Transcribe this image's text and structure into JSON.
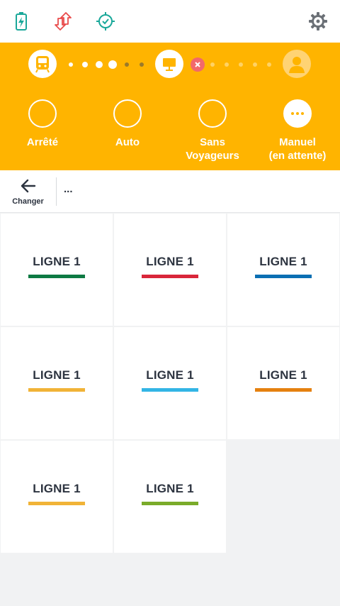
{
  "topbar": {
    "icons": [
      "battery-charging-icon",
      "sync-arrows-icon",
      "gps-target-icon",
      "gear-icon"
    ],
    "colors": {
      "battery": "#1aa89a",
      "sync": "#e94b4b",
      "gps": "#1aa89a",
      "gear": "#6b7076"
    }
  },
  "status": {
    "background": "#ffb400",
    "progress": {
      "stages": [
        "train-icon",
        "station-icon",
        "user-icon"
      ],
      "error_icon": "close-icon"
    },
    "modes": [
      {
        "label": "Arrêté",
        "state": "empty"
      },
      {
        "label": "Auto",
        "state": "empty"
      },
      {
        "label": "Sans\nVoyageurs",
        "state": "empty"
      },
      {
        "label": "Manuel\n(en attente)",
        "state": "active",
        "icon": "more-dots-icon"
      }
    ]
  },
  "subbar": {
    "back_label": "Changer",
    "crumb": "..."
  },
  "lines": [
    {
      "name": "LIGNE 1",
      "color": "#0e7a43"
    },
    {
      "name": "LIGNE 1",
      "color": "#d9263a"
    },
    {
      "name": "LIGNE 1",
      "color": "#0b6fb3"
    },
    {
      "name": "LIGNE 1",
      "color": "#f1b337"
    },
    {
      "name": "LIGNE 1",
      "color": "#33b5e5"
    },
    {
      "name": "LIGNE 1",
      "color": "#e5810f"
    },
    {
      "name": "LIGNE 1",
      "color": "#f1b337"
    },
    {
      "name": "LIGNE 1",
      "color": "#7aab2a"
    }
  ]
}
